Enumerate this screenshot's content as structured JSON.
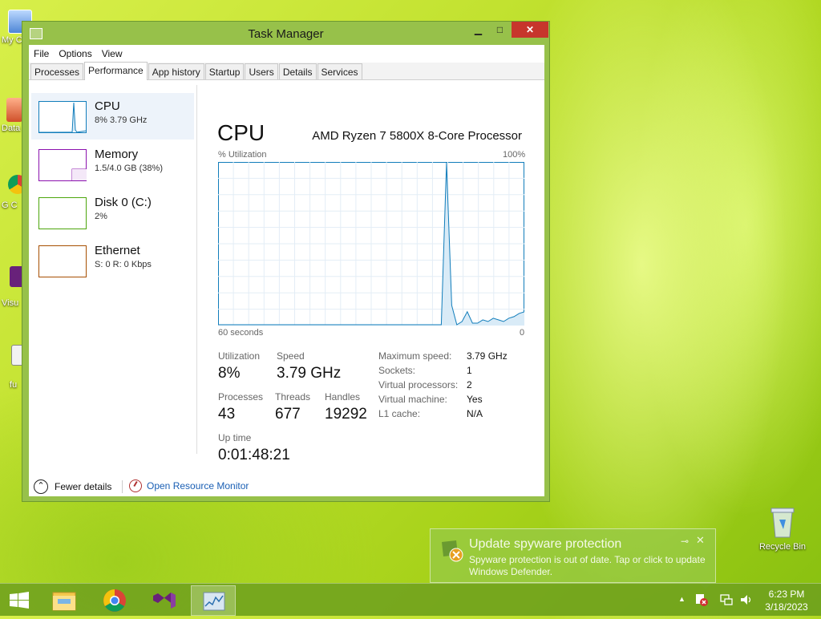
{
  "desktop": {
    "icons": [
      {
        "label": "My C"
      },
      {
        "label": "Data"
      },
      {
        "label": "G C"
      },
      {
        "label": "Visu"
      },
      {
        "label": "fu"
      }
    ],
    "recycle_bin": "Recycle Bin"
  },
  "window": {
    "title": "Task Manager",
    "min_symbol": "▁",
    "max_symbol": "□",
    "close_symbol": "✕",
    "menu": [
      "File",
      "Options",
      "View"
    ],
    "tabs": [
      "Processes",
      "Performance",
      "App history",
      "Startup",
      "Users",
      "Details",
      "Services"
    ],
    "active_tab": "Performance"
  },
  "resources": [
    {
      "name": "CPU",
      "detail": "8%  3.79 GHz",
      "color": "#117dbb",
      "selected": true
    },
    {
      "name": "Memory",
      "detail": "1.5/4.0 GB (38%)",
      "color": "#8b12ae",
      "selected": false
    },
    {
      "name": "Disk 0 (C:)",
      "detail": "2%",
      "color": "#4da60c",
      "selected": false
    },
    {
      "name": "Ethernet",
      "detail": "S: 0  R: 0 Kbps",
      "color": "#a74f01",
      "selected": false
    }
  ],
  "cpu": {
    "title": "CPU",
    "model": "AMD Ryzen 7 5800X 8-Core Processor",
    "graph_label": "% Utilization",
    "graph_max": "100%",
    "graph_time": "60 seconds",
    "graph_min": "0",
    "history": [
      0,
      0,
      0,
      0,
      0,
      0,
      0,
      0,
      0,
      0,
      0,
      0,
      0,
      0,
      0,
      0,
      0,
      0,
      0,
      0,
      0,
      0,
      0,
      0,
      0,
      0,
      0,
      0,
      0,
      0,
      0,
      0,
      0,
      0,
      0,
      0,
      0,
      0,
      0,
      0,
      0,
      0,
      0,
      0,
      100,
      12,
      0,
      2,
      8,
      1,
      1,
      3,
      2,
      4,
      3,
      2,
      4,
      5,
      7,
      8
    ],
    "stats": {
      "utilization_label": "Utilization",
      "utilization": "8%",
      "speed_label": "Speed",
      "speed": "3.79 GHz",
      "processes_label": "Processes",
      "processes": "43",
      "threads_label": "Threads",
      "threads": "677",
      "handles_label": "Handles",
      "handles": "19292",
      "uptime_label": "Up time",
      "uptime": "0:01:48:21"
    },
    "details": [
      {
        "key": "Maximum speed:",
        "value": "3.79 GHz"
      },
      {
        "key": "Sockets:",
        "value": "1"
      },
      {
        "key": "Virtual processors:",
        "value": "2"
      },
      {
        "key": "Virtual machine:",
        "value": "Yes"
      },
      {
        "key": "L1 cache:",
        "value": "N/A"
      }
    ]
  },
  "footer": {
    "fewer_details": "Fewer details",
    "fewer_symbol": "⌃",
    "open_resource_monitor": "Open Resource Monitor"
  },
  "notification": {
    "title": "Update spyware protection",
    "body": "Spyware protection is out of date. Tap or click to update Windows Defender.",
    "pin_symbol": "⊸",
    "close_symbol": "✕"
  },
  "taskbar": {
    "apps": [
      "file-explorer",
      "chrome",
      "visual-studio",
      "task-manager"
    ],
    "active_app": "task-manager",
    "up_arrow": "▲",
    "time": "6:23 PM",
    "date": "3/18/2023"
  }
}
